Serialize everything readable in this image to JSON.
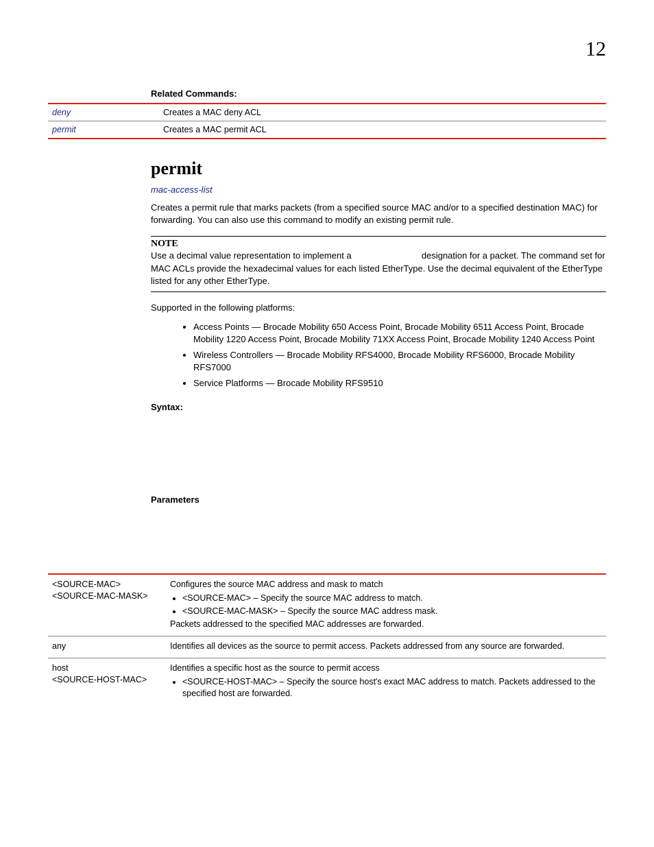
{
  "chapter": "12",
  "related": {
    "heading": "Related Commands:",
    "rows": [
      {
        "cmd": "deny",
        "desc": "Creates a MAC deny ACL"
      },
      {
        "cmd": "permit",
        "desc": "Creates a MAC permit ACL"
      }
    ]
  },
  "command": {
    "title": "permit",
    "context_link": "mac-access-list",
    "intro": "Creates a permit rule that marks packets (from a specified source MAC and/or to a specified destination MAC) for forwarding. You can also use this command to modify an existing permit rule.",
    "note_label": "NOTE",
    "note_pre": "Use a decimal value representation to implement a ",
    "note_post": " designation for a packet. The command set for MAC ACLs provide the hexadecimal values for each listed EtherType. Use the decimal equivalent of the EtherType listed for any other EtherType.",
    "supported_heading": "Supported in the following platforms:",
    "platforms": [
      "Access Points — Brocade Mobility 650 Access Point, Brocade Mobility 6511 Access Point, Brocade Mobility 1220 Access Point, Brocade Mobility 71XX Access Point, Brocade Mobility 1240 Access Point",
      "Wireless Controllers — Brocade Mobility RFS4000, Brocade Mobility RFS6000, Brocade Mobility RFS7000",
      "Service Platforms — Brocade Mobility RFS9510"
    ],
    "syntax_label": "Syntax:",
    "parameters_label": "Parameters"
  },
  "parameters": [
    {
      "name_lines": [
        "<SOURCE-MAC>",
        "<SOURCE-MAC-MASK>"
      ],
      "lead": "Configures the source MAC address and mask to match",
      "bullets": [
        "<SOURCE-MAC> – Specify the source MAC address to match.",
        "<SOURCE-MAC-MASK> – Specify the source MAC address mask."
      ],
      "trail": "Packets addressed to the specified MAC addresses are forwarded."
    },
    {
      "name_lines": [
        "any"
      ],
      "lead": "Identifies all devices as the source to permit access. Packets addressed from any source are forwarded.",
      "bullets": [],
      "trail": ""
    },
    {
      "name_lines": [
        "host",
        "<SOURCE-HOST-MAC>"
      ],
      "lead": "Identifies a specific host as the source to permit access",
      "bullets": [
        "<SOURCE-HOST-MAC> – Specify the source host's exact MAC address to match. Packets addressed to the specified host are forwarded."
      ],
      "trail": ""
    }
  ]
}
